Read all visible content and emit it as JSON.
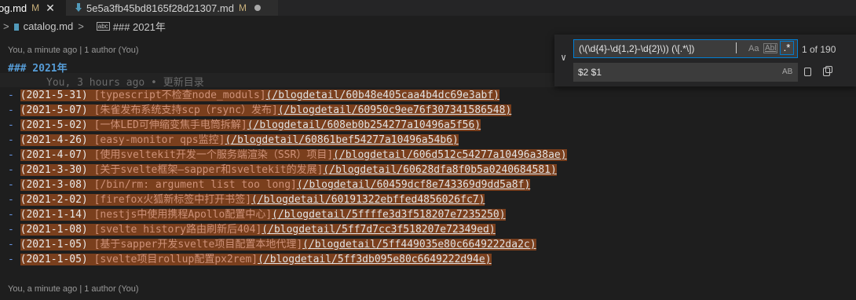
{
  "tabs": [
    {
      "name": "og.md",
      "status": "M",
      "active": true
    },
    {
      "name": "5e5a3fb45bd8165f28d21307.md",
      "status": "M",
      "active": false
    }
  ],
  "breadcrumb": {
    "file": "catalog.md",
    "symbol": "### 2021年"
  },
  "codelens_top": "You, a minute ago | 1 author (You)",
  "heading": "### 2021年",
  "blame": "You, 3 hours ago • 更新目录",
  "entries": [
    {
      "date": "(2021-5-31)",
      "title": "[typescript不检查node_moduls]",
      "url": "(/blogdetail/60b48e405caa4b4dc69e3abf)"
    },
    {
      "date": "(2021-5-07)",
      "title": "[朱雀发布系统支持scp（rsync）发布]",
      "url": "(/blogdetail/60950c9ee76f307341586548)"
    },
    {
      "date": "(2021-5-02)",
      "title": "[一体LED可伸缩变焦手电筒拆解]",
      "url": "(/blogdetail/608eb0b254277a10496a5f56)"
    },
    {
      "date": "(2021-4-26)",
      "title": "[easy-monitor qps监控]",
      "url": "(/blogdetail/60861bef54277a10496a54b6)"
    },
    {
      "date": "(2021-4-07)",
      "title": "[使用sveltekit开发一个服务端渲染（SSR）项目]",
      "url": "(/blogdetail/606d512c54277a10496a38ae)"
    },
    {
      "date": "(2021-3-30)",
      "title": "[关于svelte框架—sapper和sveltekit的发展]",
      "url": "(/blogdetail/60628dfa8f0b5a0240684581)"
    },
    {
      "date": "(2021-3-08)",
      "title": "[/bin/rm: argument list too long]",
      "url": "(/blogdetail/60459dcf8e743369d9dd5a8f)"
    },
    {
      "date": "(2021-2-02)",
      "title": "[firefox火狐新标签中打开书签]",
      "url": "(/blogdetail/60191322ebffed4856026fc7)"
    },
    {
      "date": "(2021-1-14)",
      "title": "[nestjs中使用携程Apollo配置中心]",
      "url": "(/blogdetail/5ffffe3d3f518207e7235250)"
    },
    {
      "date": "(2021-1-08)",
      "title": "[svelte history路由刷新后404]",
      "url": "(/blogdetail/5ff7d7cc3f518207e72349ed)"
    },
    {
      "date": "(2021-1-05)",
      "title": "[基于sapper开发svelte项目配置本地代理]",
      "url": "(/blogdetail/5ff449035e80c6649222da2c)"
    },
    {
      "date": "(2021-1-05)",
      "title": "[svelte项目rollup配置px2rem]",
      "url": "(/blogdetail/5ff3db095e80c6649222d94e)"
    }
  ],
  "codelens_bottom": "You, a minute ago | 1 author (You)",
  "find": {
    "query": "(\\(\\d{4}-\\d{1,2}-\\d{2}\\)) (\\[.*\\])",
    "replace": "$2 $1",
    "match_count": "1 of 190",
    "opt_case": "Aa",
    "opt_word": "Abl",
    "opt_regex": ".*",
    "opt_preserve": "AB",
    "toggle_glyph": "∨"
  },
  "colors": {
    "highlight": "#7a3f1d",
    "accent": "#007fd4"
  }
}
